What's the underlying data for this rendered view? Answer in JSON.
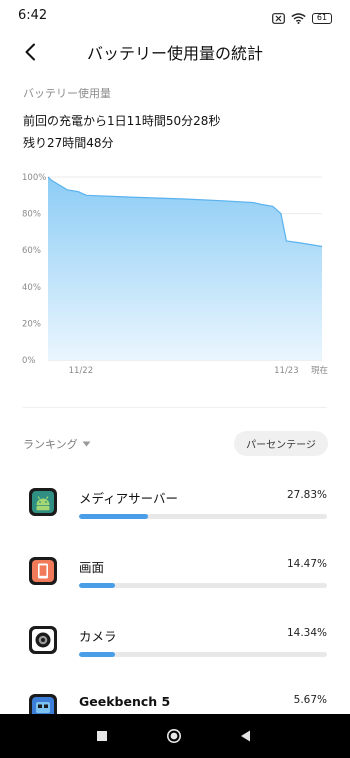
{
  "status_bar": {
    "time": "6:42",
    "battery_level": "61",
    "icons": [
      "notification-x-icon",
      "wifi-icon",
      "battery-icon"
    ]
  },
  "header": {
    "title": "バッテリー使用量の統計",
    "back_icon": "back-arrow-icon"
  },
  "summary": {
    "section_label": "バッテリー使用量",
    "since_charge": "前回の充電から1日11時間50分28秒",
    "remaining": "残り27時間48分"
  },
  "chart_data": {
    "type": "area",
    "title": "",
    "xlabel": "",
    "ylabel": "",
    "y_ticks": [
      "100%",
      "80%",
      "60%",
      "40%",
      "20%",
      "0%"
    ],
    "x_ticks": [
      {
        "label": "11/22",
        "at": 0.12
      },
      {
        "label": "11/23",
        "at": 0.87
      },
      {
        "label": "現在",
        "at": 1.0
      }
    ],
    "ylim": [
      0,
      100
    ],
    "x": [
      0,
      0.015,
      0.07,
      0.11,
      0.14,
      0.3,
      0.5,
      0.64,
      0.75,
      0.78,
      0.82,
      0.85,
      0.87,
      0.92,
      1.0
    ],
    "values": [
      100,
      98,
      93,
      92,
      90,
      89,
      88,
      87,
      86,
      85,
      84,
      80,
      65,
      64,
      62
    ],
    "line_color": "#5ab2ee",
    "fill_top_color": "#8cccf5",
    "fill_bottom_color": "#eaf6fe",
    "grid": true
  },
  "ranking": {
    "label": "ランキング",
    "toggle_label": "パーセンテージ"
  },
  "apps": [
    {
      "name": "メディアサーバー",
      "percent": "27.83%",
      "share": 0.2783,
      "icon": "android-media-server-icon"
    },
    {
      "name": "画面",
      "percent": "14.47%",
      "share": 0.1447,
      "icon": "screen-icon"
    },
    {
      "name": "カメラ",
      "percent": "14.34%",
      "share": 0.1434,
      "icon": "camera-icon"
    },
    {
      "name": "Geekbench 5",
      "percent": "5.67%",
      "share": 0.0567,
      "icon": "geekbench-icon"
    }
  ],
  "nav_bar": {
    "icons": [
      "recents-icon",
      "home-icon",
      "back-icon"
    ]
  },
  "colors": {
    "accent": "#4a9ee8",
    "track": "#e8e8e8"
  }
}
